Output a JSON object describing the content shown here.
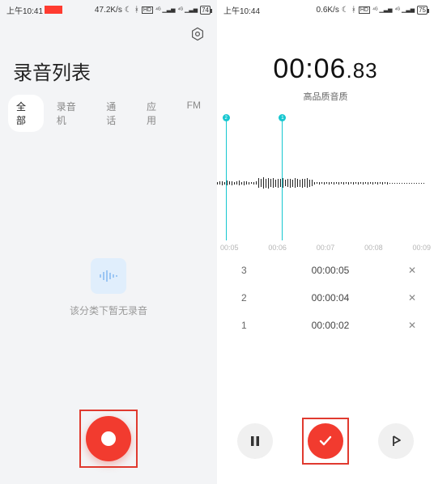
{
  "left": {
    "status": {
      "time": "上午10:41",
      "net": "47.2K/s",
      "battery": "74"
    },
    "title": "录音列表",
    "tabs": [
      "全部",
      "录音机",
      "通话",
      "应用",
      "FM"
    ],
    "active_tab_index": 0,
    "empty_text": "该分类下暂无录音"
  },
  "right": {
    "status": {
      "time": "上午10:44",
      "net": "0.6K/s",
      "battery": "75"
    },
    "timer_main": "00:06",
    "timer_ms": ".83",
    "quality": "高品质音质",
    "markers": [
      {
        "label": "2",
        "left_pct": 4
      },
      {
        "label": "1",
        "left_pct": 30
      }
    ],
    "axis": [
      "00:05",
      "00:06",
      "00:07",
      "00:08",
      "00:09"
    ],
    "marks": [
      {
        "idx": "3",
        "time": "00:00:05"
      },
      {
        "idx": "2",
        "time": "00:00:04"
      },
      {
        "idx": "1",
        "time": "00:00:02"
      }
    ]
  }
}
